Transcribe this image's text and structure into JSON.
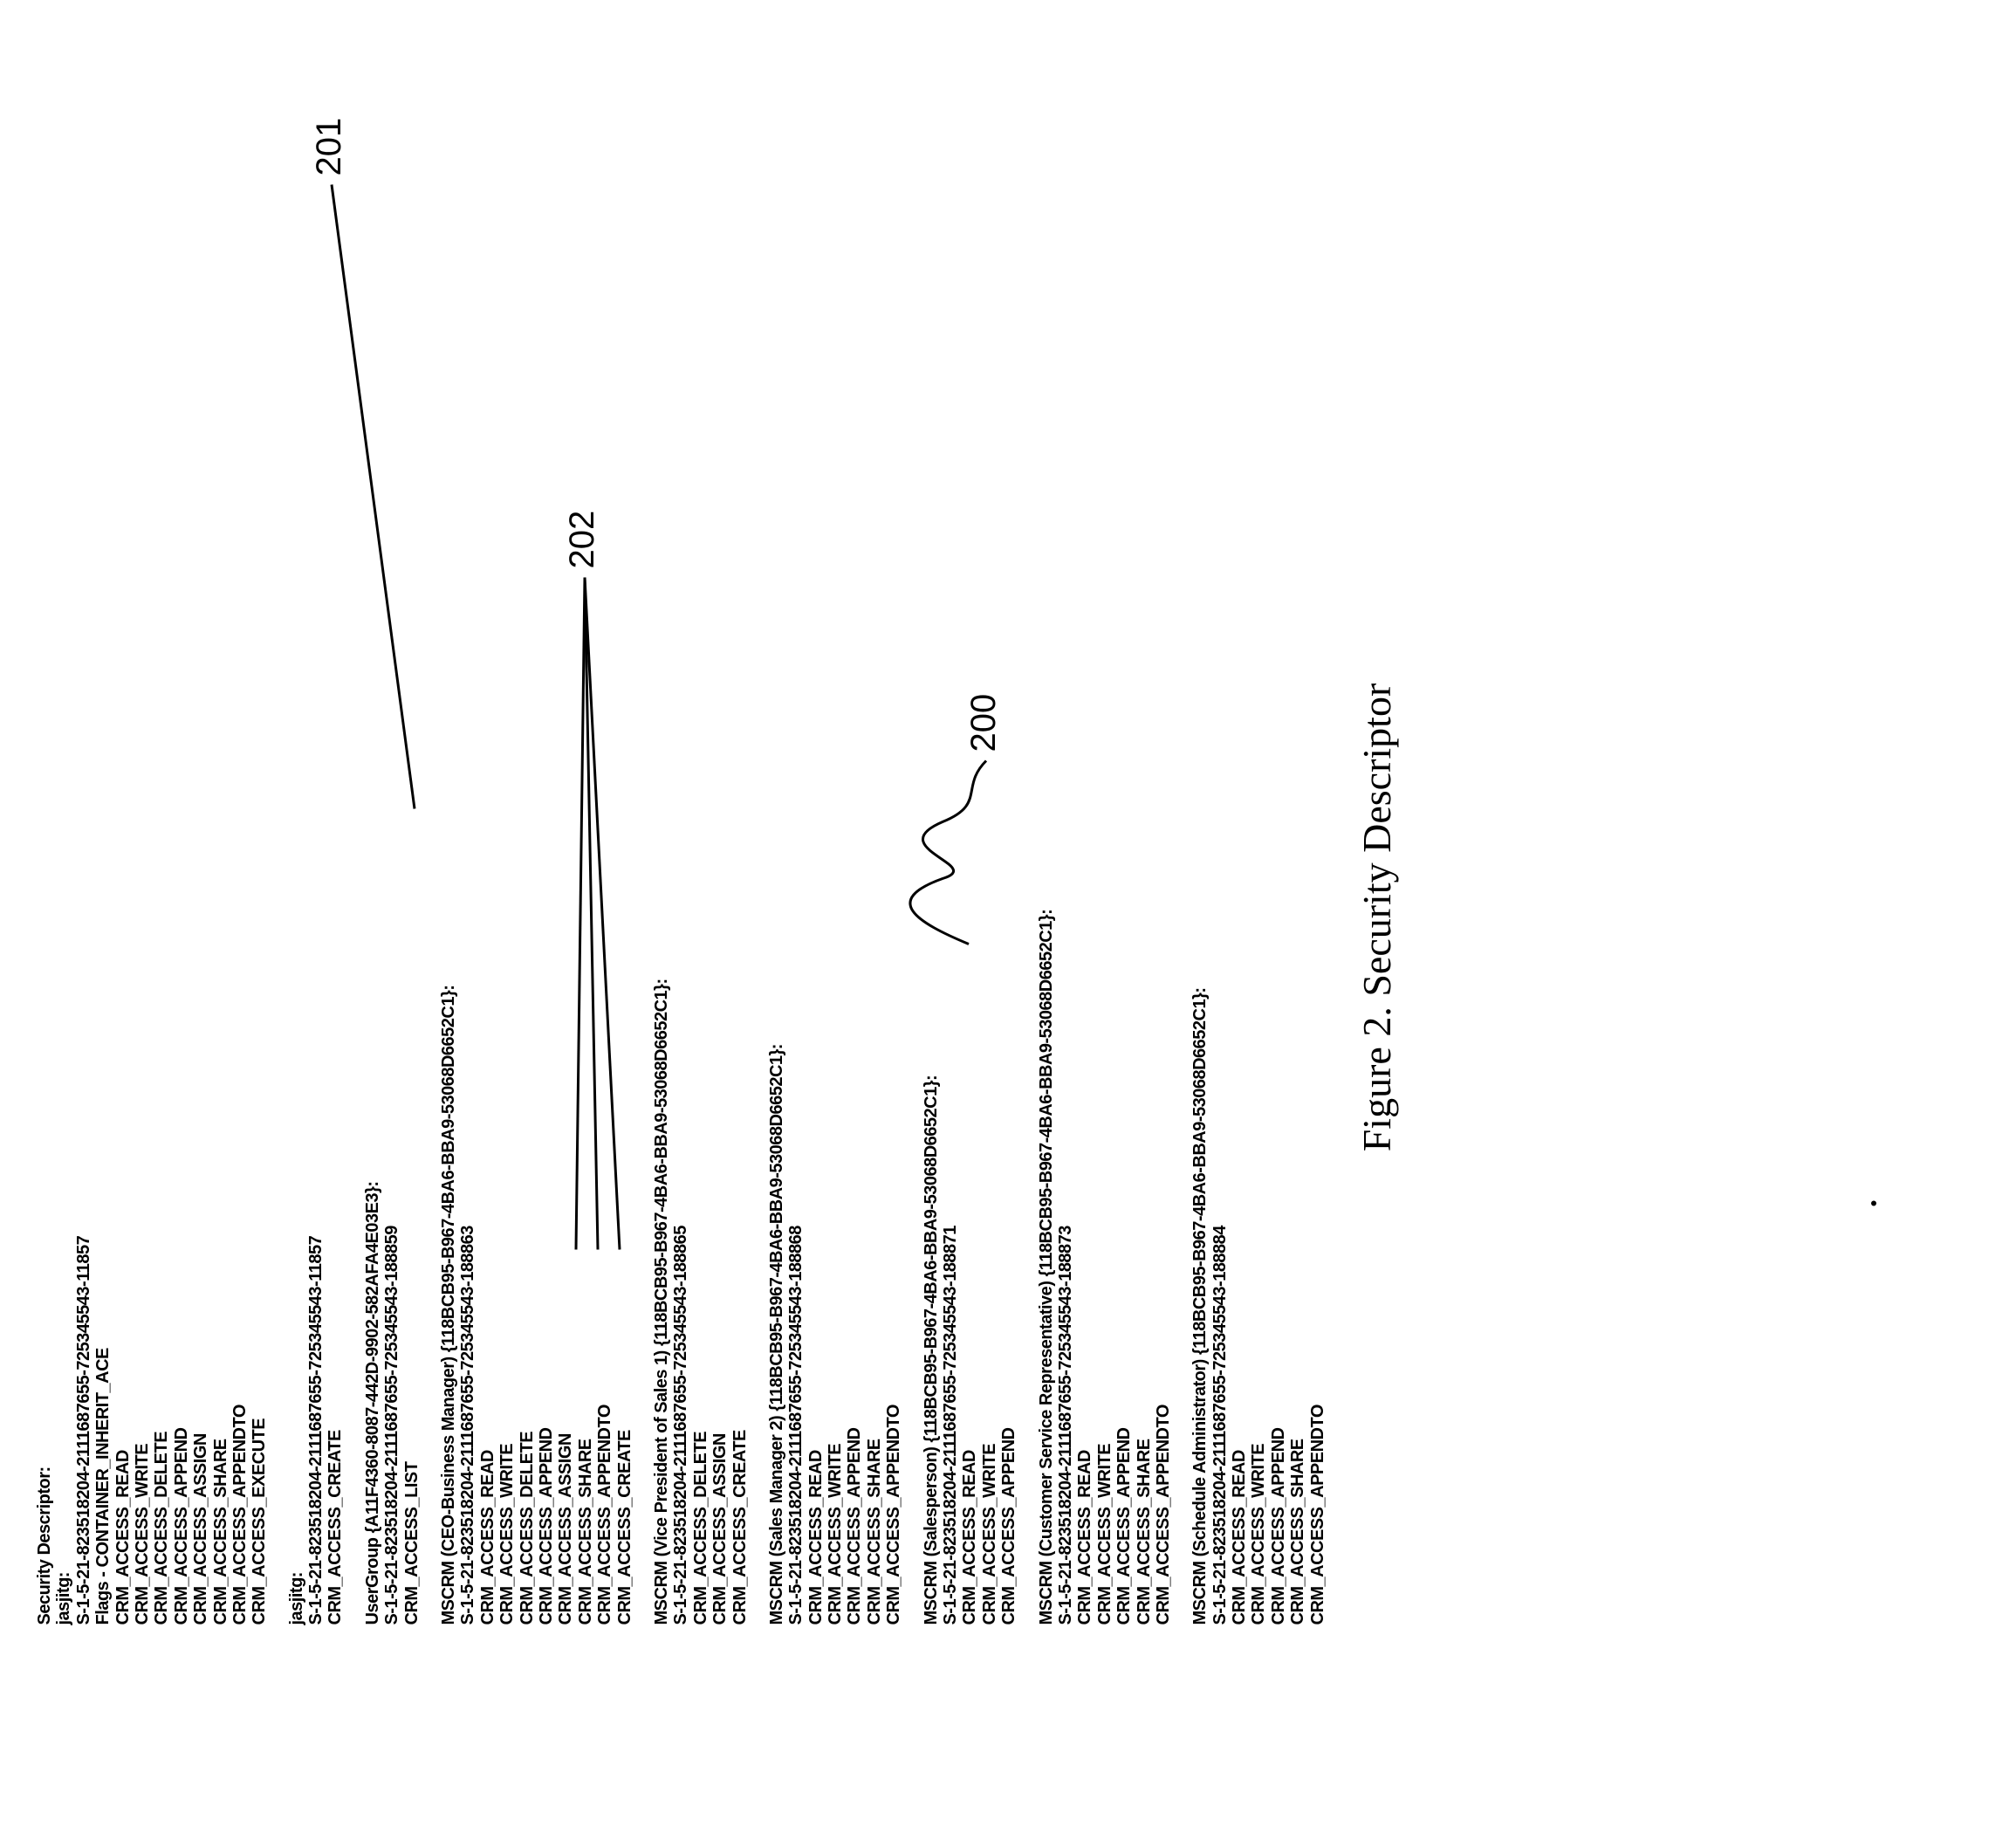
{
  "title": "Security Descriptor:",
  "caption": "Figure 2. Security Descriptor",
  "callouts": {
    "a": "201",
    "b": "202",
    "c": "200"
  },
  "entries": [
    {
      "header": "jasjitg:",
      "lines": [
        "S-1-5-21-823518204-2111687655-725345543-11857",
        "Flags - CONTAINER_INHERIT_ACE",
        "CRM_ACCESS_READ",
        "CRM_ACCESS_WRITE",
        "CRM_ACCESS_DELETE",
        "CRM_ACCESS_APPEND",
        "CRM_ACCESS_ASSIGN",
        "CRM_ACCESS_SHARE",
        "CRM_ACCESS_APPENDTO",
        "CRM_ACCESS_EXECUTE"
      ]
    },
    {
      "header": "jasjitg:",
      "lines": [
        "S-1-5-21-823518204-2111687655-725345543-11857",
        "CRM_ACCESS_CREATE"
      ]
    },
    {
      "header": "UserGroup {A11F4360-8087-442D-9902-582AFA4E03E3}:",
      "lines": [
        "S-1-5-21-823518204-2111687655-725345543-188859",
        "CRM_ACCESS_LIST"
      ]
    },
    {
      "header": "MSCRM (CEO-Business Manager) {118BCB95-B967-4BA6-BBA9-53068D6652C1}:",
      "lines": [
        "S-1-5-21-823518204-2111687655-725345543-188863",
        "CRM_ACCESS_READ",
        "CRM_ACCESS_WRITE",
        "CRM_ACCESS_DELETE",
        "CRM_ACCESS_APPEND",
        "CRM_ACCESS_ASSIGN",
        "CRM_ACCESS_SHARE",
        "CRM_ACCESS_APPENDTO",
        "CRM_ACCESS_CREATE"
      ]
    },
    {
      "header": "MSCRM (Vice President of Sales 1) {118BCB95-B967-4BA6-BBA9-53068D6652C1}:",
      "lines": [
        "S-1-5-21-823518204-2111687655-725345543-188865",
        "CRM_ACCESS_DELETE",
        "CRM_ACCESS_ASSIGN",
        "CRM_ACCESS_CREATE"
      ]
    },
    {
      "header": "MSCRM (Sales Manager 2) {118BCB95-B967-4BA6-BBA9-53068D6652C1}:",
      "lines": [
        "S-1-5-21-823518204-2111687655-725345543-188868",
        "CRM_ACCESS_READ",
        "CRM_ACCESS_WRITE",
        "CRM_ACCESS_APPEND",
        "CRM_ACCESS_SHARE",
        "CRM_ACCESS_APPENDTO"
      ]
    },
    {
      "header": "MSCRM (Salesperson) {118BCB95-B967-4BA6-BBA9-53068D6652C1}:",
      "lines": [
        "S-1-5-21-823518204-2111687655-725345543-188871",
        "CRM_ACCESS_READ",
        "CRM_ACCESS_WRITE",
        "CRM_ACCESS_APPEND"
      ]
    },
    {
      "header": "MSCRM (Customer Service Representative) {118BCB95-B967-4BA6-BBA9-53068D6652C1}:",
      "lines": [
        "S-1-5-21-823518204-2111687655-725345543-188873",
        "CRM_ACCESS_READ",
        "CRM_ACCESS_WRITE",
        "CRM_ACCESS_APPEND",
        "CRM_ACCESS_SHARE",
        "CRM_ACCESS_APPENDTO"
      ]
    },
    {
      "header": "MSCRM (Schedule Administrator) {118BCB95-B967-4BA6-BBA9-53068D6652C1}:",
      "lines": [
        "S-1-5-21-823518204-2111687655-725345543-188884",
        "CRM_ACCESS_READ",
        "CRM_ACCESS_WRITE",
        "CRM_ACCESS_APPEND",
        "CRM_ACCESS_SHARE",
        "CRM_ACCESS_APPENDTO"
      ]
    }
  ]
}
